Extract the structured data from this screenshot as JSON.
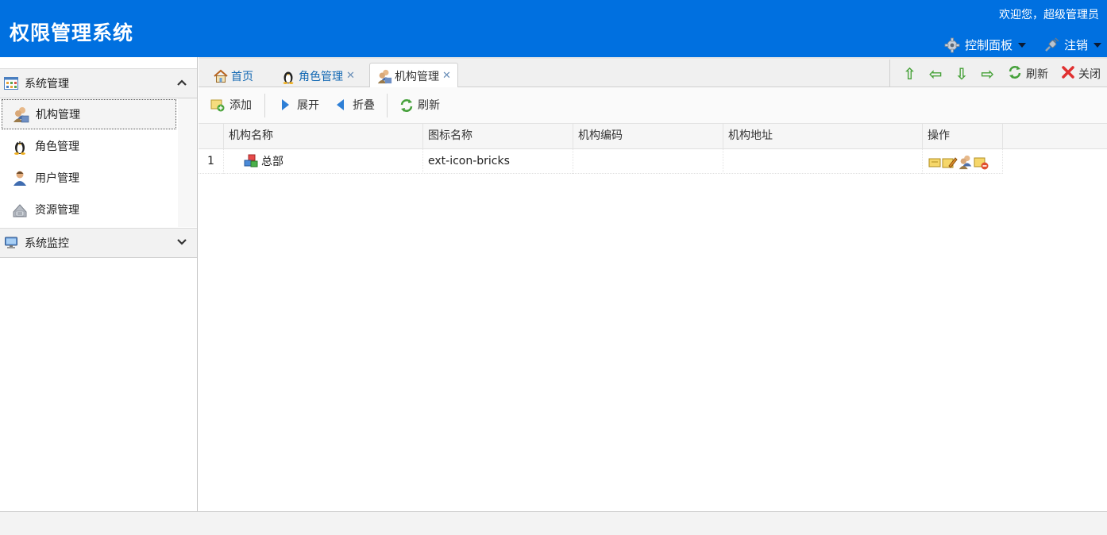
{
  "header": {
    "title": "权限管理系统",
    "welcome": "欢迎您，超级管理员",
    "control_panel": "控制面板",
    "logout": "注销"
  },
  "sidebar": {
    "groups": [
      {
        "label": "系统管理",
        "expanded": true,
        "items": [
          {
            "label": "机构管理",
            "icon": "group-icon",
            "selected": true
          },
          {
            "label": "角色管理",
            "icon": "penguin-icon"
          },
          {
            "label": "用户管理",
            "icon": "user-icon"
          },
          {
            "label": "资源管理",
            "icon": "database-icon"
          }
        ]
      },
      {
        "label": "系统监控",
        "expanded": false
      }
    ]
  },
  "tabs": [
    {
      "label": "首页",
      "icon": "home-icon",
      "closable": false
    },
    {
      "label": "角色管理",
      "icon": "penguin-icon",
      "closable": true
    },
    {
      "label": "机构管理",
      "icon": "group-icon",
      "closable": true,
      "active": true
    }
  ],
  "tab_tools": {
    "refresh": "刷新",
    "close": "关闭"
  },
  "toolbar": {
    "add": "添加",
    "expand": "展开",
    "collapse": "折叠",
    "refresh": "刷新"
  },
  "grid": {
    "columns": [
      "机构名称",
      "图标名称",
      "机构编码",
      "机构地址",
      "操作"
    ],
    "rows": [
      {
        "index": "1",
        "name": "总部",
        "icon_name": "ext-icon-bricks",
        "code": "",
        "address": ""
      }
    ]
  },
  "colors": {
    "header_bg": "#0070e0",
    "link": "#1268b3",
    "arrow_green": "#48a23a",
    "close_red": "#e03030"
  }
}
